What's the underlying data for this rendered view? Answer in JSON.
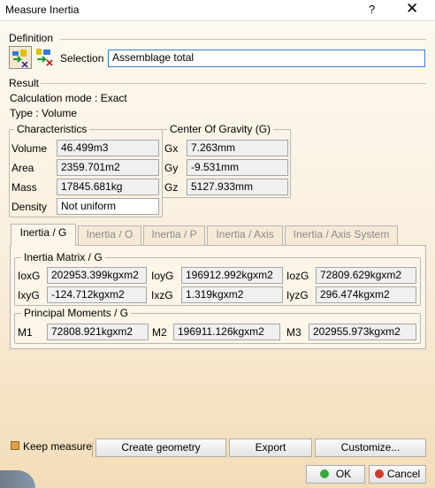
{
  "window": {
    "title": "Measure Inertia",
    "help": "?",
    "close": "✕"
  },
  "definition": {
    "label": "Definition",
    "selection_label": "Selection :",
    "selection_value": "Assemblage total"
  },
  "result": {
    "label": "Result",
    "calc_mode": "Calculation mode : Exact",
    "type": "Type : Volume"
  },
  "characteristics": {
    "label": "Characteristics",
    "rows": [
      {
        "label": "Volume",
        "value": "46.499m3"
      },
      {
        "label": "Area",
        "value": "2359.701m2"
      },
      {
        "label": "Mass",
        "value": "17845.681kg"
      },
      {
        "label": "Density",
        "value": "Not uniform"
      }
    ]
  },
  "cog": {
    "label": "Center Of Gravity (G)",
    "rows": [
      {
        "label": "Gx",
        "value": "7.263mm"
      },
      {
        "label": "Gy",
        "value": "-9.531mm"
      },
      {
        "label": "Gz",
        "value": "5127.933mm"
      }
    ]
  },
  "tabs": [
    {
      "label": "Inertia / G",
      "active": true
    },
    {
      "label": "Inertia / O",
      "active": false
    },
    {
      "label": "Inertia / P",
      "active": false
    },
    {
      "label": "Inertia / Axis",
      "active": false
    },
    {
      "label": "Inertia / Axis System",
      "active": false
    }
  ],
  "inertia_matrix": {
    "label": "Inertia Matrix / G",
    "row1": [
      {
        "label": "IoxG",
        "value": "202953.399kgxm2"
      },
      {
        "label": "IoyG",
        "value": "196912.992kgxm2"
      },
      {
        "label": "IozG",
        "value": "72809.629kgxm2"
      }
    ],
    "row2": [
      {
        "label": "IxyG",
        "value": "-124.712kgxm2"
      },
      {
        "label": "IxzG",
        "value": "1.319kgxm2"
      },
      {
        "label": "IyzG",
        "value": "296.474kgxm2"
      }
    ]
  },
  "principal_moments": {
    "label": "Principal Moments / G",
    "row": [
      {
        "label": "M1",
        "value": "72808.921kgxm2"
      },
      {
        "label": "M2",
        "value": "196911.126kgxm2"
      },
      {
        "label": "M3",
        "value": "202955.973kgxm2"
      }
    ]
  },
  "footer": {
    "keep_measure": "Keep measure",
    "create_geometry": "Create geometry",
    "export": "Export",
    "customize": "Customize...",
    "ok": "OK",
    "cancel": "Cancel"
  },
  "colors": {
    "ok_green": "#3aa63a",
    "cancel_red": "#d03a2a",
    "keep_check": "#e0a040"
  }
}
